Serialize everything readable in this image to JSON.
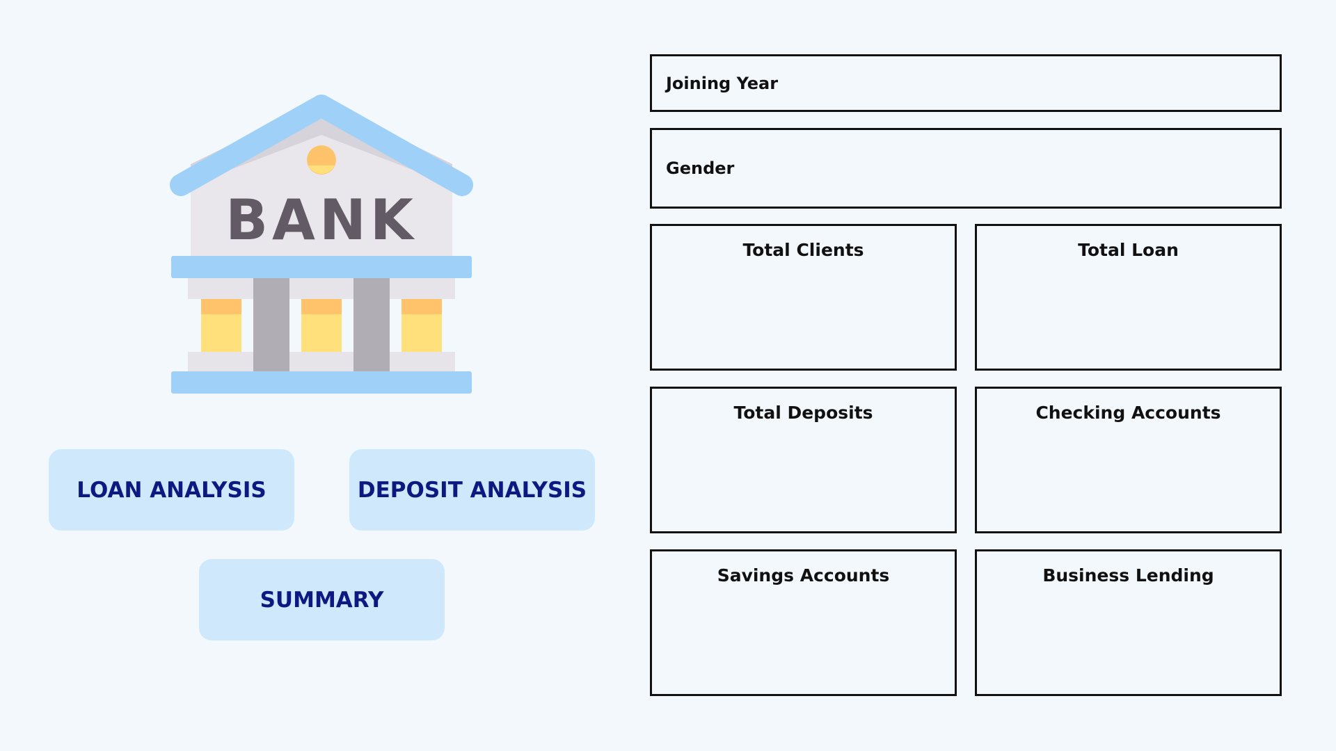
{
  "logo": {
    "text": "BANK",
    "icon": "bank-building-icon"
  },
  "nav": {
    "loan_analysis": "LOAN ANALYSIS",
    "deposit_analysis": "DEPOSIT ANALYSIS",
    "summary": "SUMMARY"
  },
  "filters": {
    "joining_year": "Joining Year",
    "gender": "Gender"
  },
  "kpis": [
    {
      "label": "Total Clients"
    },
    {
      "label": "Total Loan"
    },
    {
      "label": "Total Deposits"
    },
    {
      "label": "Checking Accounts"
    },
    {
      "label": "Savings Accounts"
    },
    {
      "label": "Business Lending"
    }
  ],
  "colors": {
    "background": "#f3f8fd",
    "button_bg": "#cfe8fc",
    "button_text": "#0f1880",
    "roof": "#9fd0f8",
    "border": "#111111"
  }
}
